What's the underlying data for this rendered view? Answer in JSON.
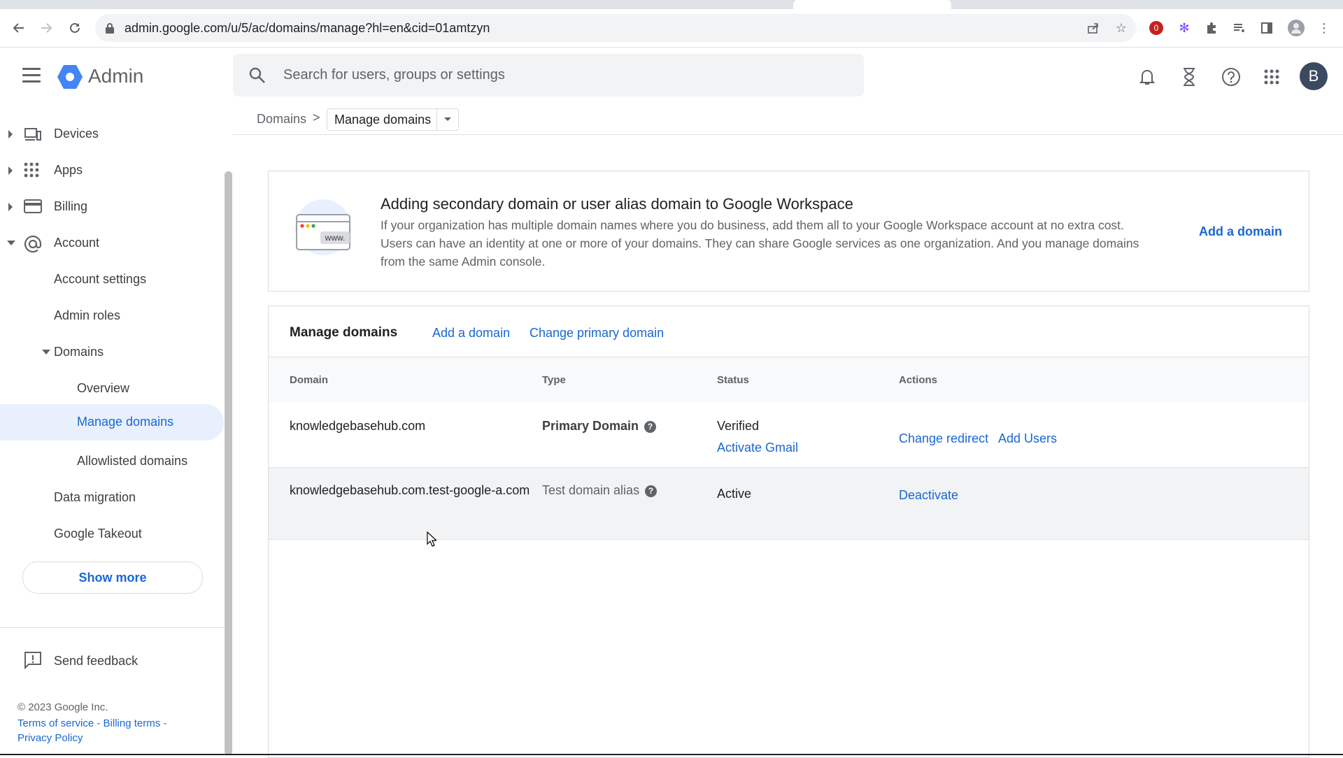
{
  "browser": {
    "url": "admin.google.com/u/5/ac/domains/manage?hl=en&cid=01amtzyn",
    "profile_badge": "0"
  },
  "header": {
    "app_name": "Admin",
    "search_placeholder": "Search for users, groups or settings",
    "avatar_letter": "B"
  },
  "breadcrumb": {
    "parent": "Domains",
    "separator": ">",
    "current": "Manage domains"
  },
  "sidebar": {
    "items": [
      {
        "label": "Devices"
      },
      {
        "label": "Apps"
      },
      {
        "label": "Billing"
      },
      {
        "label": "Account"
      },
      {
        "label": "Account settings"
      },
      {
        "label": "Admin roles"
      },
      {
        "label": "Domains"
      },
      {
        "label": "Overview"
      },
      {
        "label": "Manage domains"
      },
      {
        "label": "Allowlisted domains"
      },
      {
        "label": "Data migration"
      },
      {
        "label": "Google Takeout"
      }
    ],
    "show_more": "Show more",
    "send_feedback": "Send feedback",
    "copyright": "© 2023 Google Inc.",
    "terms": "Terms of service",
    "billing_terms": "Billing terms",
    "privacy": "Privacy Policy",
    "footer_sep": " - "
  },
  "info_card": {
    "illustration_text": "www.",
    "title": "Adding secondary domain or user alias domain to Google Workspace",
    "description": "If your organization has multiple domain names where you do business, add them all to your Google Workspace account at no extra cost. Users can have an identity at one or more of your domains. They can share Google services as one organization. And you manage domains from the same Admin console.",
    "action": "Add a domain"
  },
  "manage": {
    "title": "Manage domains",
    "add_link": "Add a domain",
    "change_primary_link": "Change primary domain",
    "columns": [
      "Domain",
      "Type",
      "Status",
      "Actions"
    ],
    "rows": [
      {
        "domain": "knowledgebasehub.com",
        "type": "Primary Domain",
        "status": "Verified",
        "status_link": "Activate Gmail",
        "actions": [
          "Change redirect",
          "Add Users"
        ]
      },
      {
        "domain": "knowledgebasehub.com.test-google-a.com",
        "type": "Test domain alias",
        "status": "Active",
        "actions": [
          "Deactivate"
        ]
      }
    ]
  },
  "icons": [
    "back-icon",
    "forward-icon",
    "reload-icon",
    "lock-icon",
    "share-icon",
    "star-icon",
    "extensions-icon",
    "menu-icon",
    "search-icon",
    "notifications-icon",
    "hourglass-icon",
    "help-icon",
    "apps-grid-icon",
    "feedback-icon",
    "help-circle-icon"
  ],
  "colors": {
    "link": "#1967d2",
    "active_bg": "#e8f0fe",
    "logo_blue": "#4285f4"
  }
}
